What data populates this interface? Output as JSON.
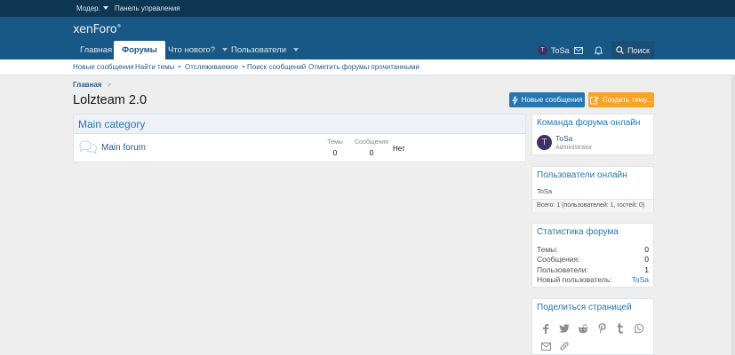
{
  "staffbar": {
    "moderator": "Модер.",
    "admin_panel": "Панель управления"
  },
  "header": {
    "logo_text": "xenForo",
    "logo_mark": "®",
    "tabs": [
      {
        "label": "Главная",
        "active": false,
        "dropdown": false
      },
      {
        "label": "Форумы",
        "active": true,
        "dropdown": false
      },
      {
        "label": "Что нового?",
        "active": false,
        "dropdown": true
      },
      {
        "label": "Пользователи",
        "active": false,
        "dropdown": true
      }
    ],
    "user": {
      "initial": "T",
      "name": "ToSa"
    },
    "search_label": "Поиск"
  },
  "subnav": {
    "items": [
      {
        "label": "Новые сообщения",
        "dropdown": false
      },
      {
        "label": "Найти темы",
        "dropdown": true
      },
      {
        "label": "Отслеживаемое",
        "dropdown": true
      },
      {
        "label": "Поиск сообщений",
        "dropdown": false
      },
      {
        "label": "Отметить форумы прочитанными",
        "dropdown": false
      }
    ]
  },
  "breadcrumb": {
    "home": "Главная",
    "sep": ">"
  },
  "page_title": "Lolzteam 2.0",
  "buttons": {
    "new_posts": "Новые сообщения",
    "create_thread": "Создать тему..."
  },
  "forum": {
    "category": "Main category",
    "node": {
      "title": "Main forum",
      "threads_label": "Темы",
      "threads_value": "0",
      "posts_label": "Сообщения",
      "posts_value": "0",
      "latest": "Нет"
    }
  },
  "sidebar": {
    "staff": {
      "title": "Команда форума онлайн",
      "member": {
        "initial": "T",
        "name": "ToSa",
        "role": "Administrator"
      }
    },
    "online": {
      "title": "Пользователи онлайн",
      "user": "ToSa",
      "total": "Всего: 1 (пользователей: 1, гостей: 0)"
    },
    "stats": {
      "title": "Статистика форума",
      "rows": [
        {
          "label": "Темы:",
          "value": "0"
        },
        {
          "label": "Сообщения:",
          "value": "0"
        },
        {
          "label": "Пользователи:",
          "value": "1"
        },
        {
          "label": "Новый пользователь:",
          "value": "ToSa"
        }
      ]
    },
    "share": {
      "title": "Поделиться страницей",
      "icons": [
        "facebook-icon",
        "twitter-icon",
        "reddit-icon",
        "pinterest-icon",
        "tumblr-icon",
        "whatsapp-icon",
        "email-icon",
        "link-icon"
      ]
    }
  },
  "colors": {
    "staffbar": "#0f3652",
    "header": "#185886",
    "accent": "#2577b1",
    "orange": "#f7a325",
    "page_bg": "#eeeeee"
  }
}
